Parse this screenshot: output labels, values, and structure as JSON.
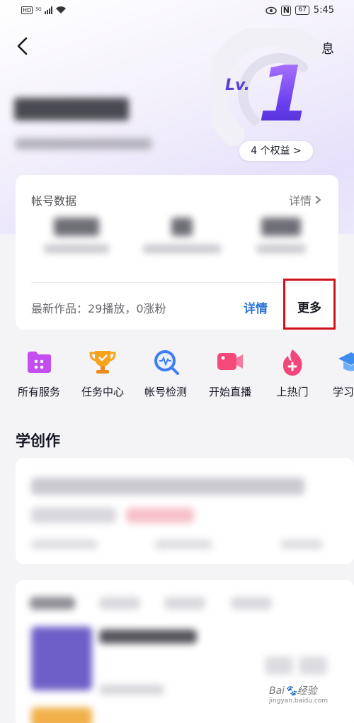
{
  "status_bar": {
    "network": "HD",
    "signal": "5G",
    "battery": "67",
    "time": "5:45"
  },
  "header": {
    "messages_label": "消息"
  },
  "level": {
    "prefix": "Lv.",
    "number": "1",
    "benefits_label": "4 个权益 >"
  },
  "account_card": {
    "title": "帐号数据",
    "detail_label": "详情",
    "latest_work": "最新作品：29播放，0涨粉",
    "latest_detail_label": "详情",
    "more_label": "更多"
  },
  "services": [
    {
      "label": "所有服务",
      "icon": "all-services-icon",
      "color": "#c44df0"
    },
    {
      "label": "任务中心",
      "icon": "trophy-icon",
      "color": "#f7a31c"
    },
    {
      "label": "帐号检测",
      "icon": "account-check-icon",
      "color": "#3e7df5"
    },
    {
      "label": "开始直播",
      "icon": "live-camera-icon",
      "color": "#f5497a"
    },
    {
      "label": "上热门",
      "icon": "hot-flame-icon",
      "color": "#f2477a"
    },
    {
      "label": "学习",
      "icon": "learn-cap-icon",
      "color": "#3d8ef0"
    }
  ],
  "learn_section": {
    "title": "学创作"
  },
  "watermark": {
    "brand": "Bai",
    "suffix": "经验",
    "url": "jingyan.baidu.com"
  }
}
